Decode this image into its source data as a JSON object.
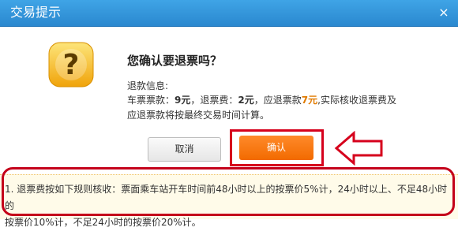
{
  "window": {
    "title": "交易提示",
    "close_symbol": "×"
  },
  "icons": {
    "help": "question-mark-icon",
    "close": "close-icon",
    "arrow": "left-arrow-annotation-icon"
  },
  "colors": {
    "title_bar": "#2a88cf",
    "confirm_button": "#f26a00",
    "highlight": "#d6001c",
    "refund_amount": "#e07a00"
  },
  "message": {
    "heading": "您确认要退票吗？",
    "info_label": "退款信息:",
    "fare_label": "车票票款：",
    "fare_value": "9元",
    "fee_label": "，退票费：",
    "fee_value": "2元",
    "refund_label": "，应退票款",
    "refund_value": "7元",
    "fee_note_tail": ",实际核收退票费及",
    "note_line": "应退票款将按最终交易时间计算。"
  },
  "buttons": {
    "cancel": "取消",
    "confirm": "确认"
  },
  "rules": {
    "line1": "1. 退票费按如下规则核收：票面乘车站开车时间前48小时以上的按票价5%计，24小时以上、不足48小时的",
    "line2": "按票价10%计，不足24小时的按票价20%计。"
  }
}
